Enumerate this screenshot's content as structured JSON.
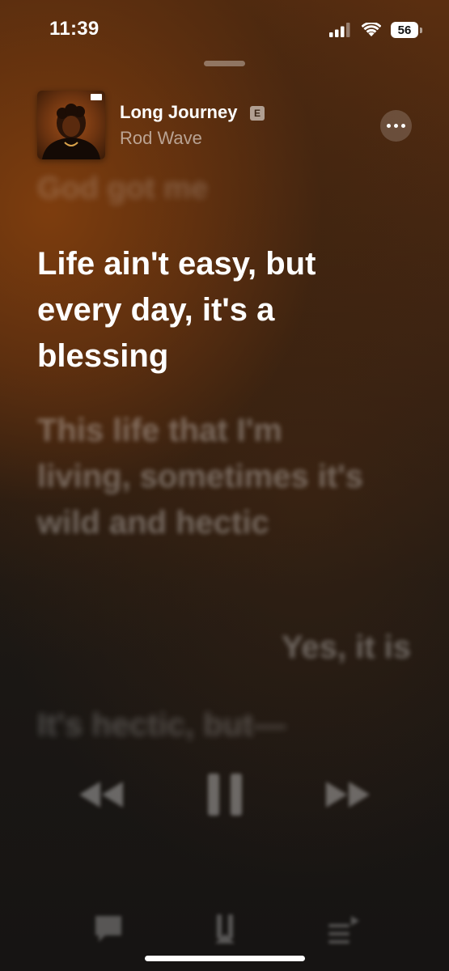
{
  "status_bar": {
    "time": "11:39",
    "battery_level": "56",
    "icons": [
      "cellular-signal-icon",
      "wifi-icon",
      "battery-icon"
    ]
  },
  "now_playing": {
    "title": "Long Journey",
    "explicit_badge": "E",
    "artist": "Rod Wave",
    "more_icon": "ellipsis-icon"
  },
  "lyrics": {
    "previous": "God got me",
    "current": "Life ain't easy, but every day, it's a blessing",
    "next": [
      "This life that I'm living, sometimes it's wild and hectic",
      "Yes, it is",
      "It's hectic, but—"
    ]
  },
  "controls": {
    "icons": [
      "rewind-icon",
      "pause-icon",
      "fast-forward-icon"
    ]
  },
  "toolbar": {
    "icons": [
      "lyrics-icon",
      "airplay-icon",
      "queue-icon"
    ]
  },
  "colors": {
    "accent_gradient_top": "#7a3c12",
    "background_bottom": "#161413",
    "current_lyric": "#ffffff"
  }
}
